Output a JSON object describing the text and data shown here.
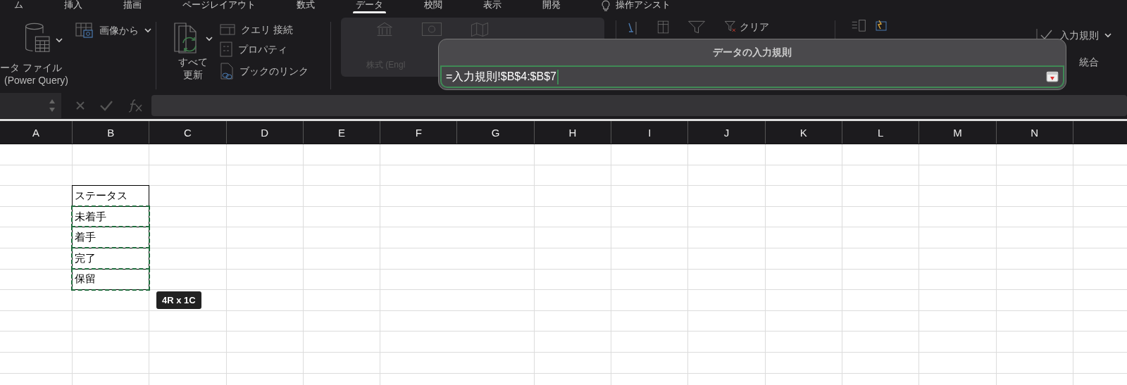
{
  "menu_tabs": [
    {
      "label": "ム",
      "selected": false
    },
    {
      "label": "挿入",
      "selected": false
    },
    {
      "label": "描画",
      "selected": false
    },
    {
      "label": "ページレイアウト",
      "selected": false
    },
    {
      "label": "数式",
      "selected": false
    },
    {
      "label": "データ",
      "selected": true
    },
    {
      "label": "校閲",
      "selected": false
    },
    {
      "label": "表示",
      "selected": false
    },
    {
      "label": "開発",
      "selected": false
    },
    {
      "label": "操作アシスト",
      "selected": false,
      "kind": "assist"
    }
  ],
  "ribbon": {
    "get_data": {
      "line1": "ータ ファイル",
      "line2": "(Power Query)"
    },
    "from_image": "画像から",
    "refresh_all": {
      "line1": "すべて",
      "line2": "更新"
    },
    "queries": [
      "クエリ  接続",
      "プロパティ",
      "ブックのリンク"
    ],
    "stocks": {
      "label": "株式 (Engl",
      "disabled": true
    },
    "clear": "クリア",
    "validation": "入力規則",
    "consolidate": "統合"
  },
  "sheet": {
    "columns": [
      "A",
      "B",
      "C",
      "D",
      "E",
      "F",
      "G",
      "H",
      "I",
      "J",
      "K",
      "L",
      "M",
      "N"
    ],
    "cells": [
      {
        "text": "ステータス",
        "in_range": false
      },
      {
        "text": "未着手",
        "in_range": true
      },
      {
        "text": "着手",
        "in_range": true
      },
      {
        "text": "完了",
        "in_range": true
      },
      {
        "text": "保留",
        "in_range": true
      }
    ],
    "range_tooltip": "4R x 1C"
  },
  "dialog": {
    "title": "データの入力規則",
    "value": "=入力規則!$B$4:$B$7"
  }
}
